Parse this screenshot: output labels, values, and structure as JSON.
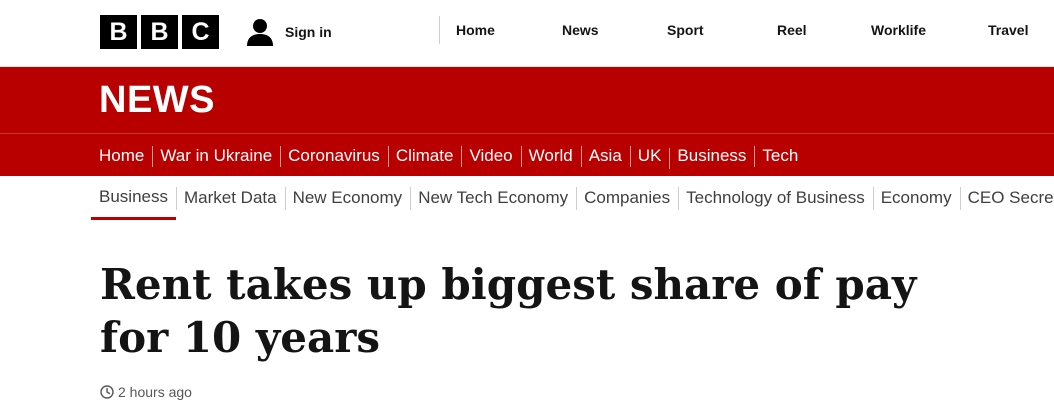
{
  "logo": {
    "letters": [
      "B",
      "B",
      "C"
    ]
  },
  "account": {
    "signin_label": "Sign in",
    "icon": "user-icon"
  },
  "top_nav": [
    "Home",
    "News",
    "Sport",
    "Reel",
    "Worklife",
    "Travel"
  ],
  "section": {
    "title": "NEWS"
  },
  "primary_nav": [
    "Home",
    "War in Ukraine",
    "Coronavirus",
    "Climate",
    "Video",
    "World",
    "Asia",
    "UK",
    "Business",
    "Tech"
  ],
  "primary_nav_active": "Business",
  "secondary_nav": [
    "Business",
    "Market Data",
    "New Economy",
    "New Tech Economy",
    "Companies",
    "Technology of Business",
    "Economy",
    "CEO Secrets"
  ],
  "secondary_nav_active": "Business",
  "article": {
    "headline": "Rent takes up biggest share of pay for 10 years",
    "timestamp": "2 hours ago",
    "timestamp_icon": "clock-icon"
  },
  "colors": {
    "brand_red": "#b80000",
    "text": "#141414",
    "muted": "#545658"
  }
}
